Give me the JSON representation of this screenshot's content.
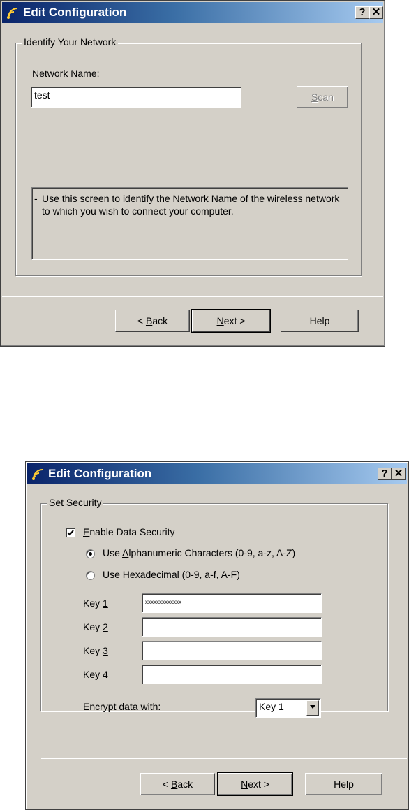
{
  "dialog1": {
    "title": "Edit Configuration",
    "help_glyph": "?",
    "close_glyph": "✕",
    "group_legend": "Identify Your Network",
    "network_name_label_pre": "Network N",
    "network_name_label_u": "a",
    "network_name_label_post": "me:",
    "network_name_value": "test",
    "scan_u": "S",
    "scan_post": "can",
    "info_text": "Use this screen to identify the Network Name of the wireless network to which you wish to connect your computer.",
    "back_pre": "< ",
    "back_u": "B",
    "back_post": "ack",
    "next_u": "N",
    "next_post": "ext >",
    "help_label": "Help"
  },
  "dialog2": {
    "title": "Edit Configuration",
    "help_glyph": "?",
    "close_glyph": "✕",
    "group_legend": "Set Security",
    "enable_u": "E",
    "enable_post": "nable Data Security",
    "enable_checked": true,
    "radio_alpha_pre": "Use ",
    "radio_alpha_u": "A",
    "radio_alpha_post": "lphanumeric Characters (0-9, a-z, A-Z)",
    "radio_alpha_selected": true,
    "radio_hex_pre": "Use ",
    "radio_hex_u": "H",
    "radio_hex_post": "exadecimal (0-9, a-f, A-F)",
    "radio_hex_selected": false,
    "key_prefix": "Key ",
    "keys": [
      {
        "num": "1",
        "value": "xxxxxxxxxxxxx"
      },
      {
        "num": "2",
        "value": ""
      },
      {
        "num": "3",
        "value": ""
      },
      {
        "num": "4",
        "value": ""
      }
    ],
    "encrypt_pre": "En",
    "encrypt_u": "c",
    "encrypt_post": "rypt data with:",
    "encrypt_value": "Key 1",
    "back_pre": "< ",
    "back_u": "B",
    "back_post": "ack",
    "next_u": "N",
    "next_post": "ext >",
    "help_label": "Help"
  },
  "colors": {
    "titlebar_start": "#0a246a",
    "titlebar_end": "#a6caf0",
    "dialog_face": "#d4d0c8"
  },
  "icons": [
    "wireless-signal-icon",
    "help-icon",
    "close-icon",
    "dropdown-arrow-icon"
  ]
}
